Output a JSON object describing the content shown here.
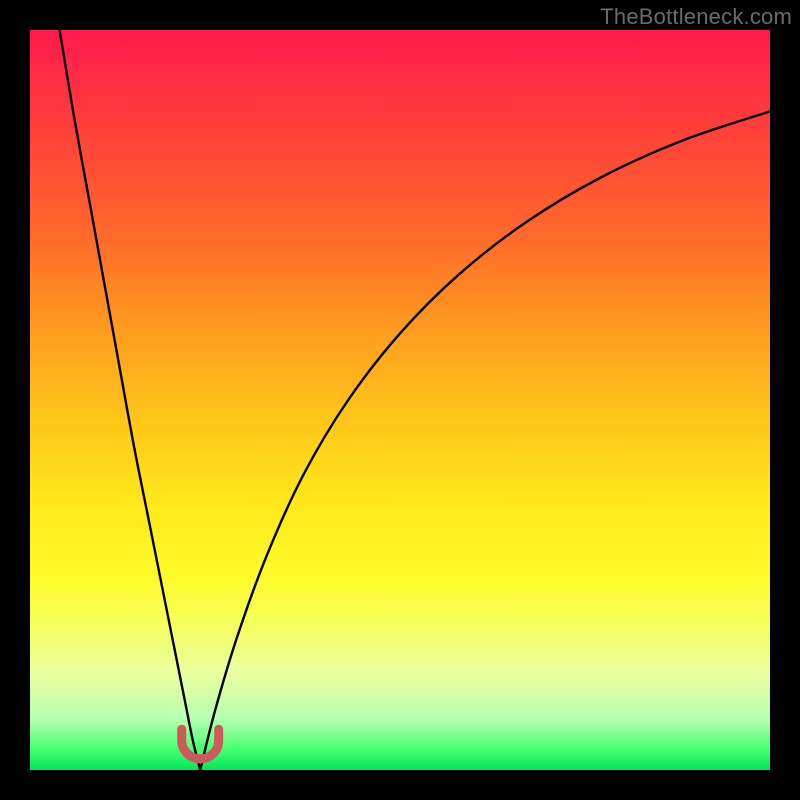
{
  "watermark": {
    "text": "TheBottleneck.com"
  },
  "chart_data": {
    "type": "line",
    "title": "",
    "xlabel": "",
    "ylabel": "",
    "xlim": [
      0,
      100
    ],
    "ylim": [
      0,
      100
    ],
    "background_gradient": {
      "orientation": "vertical",
      "stops": [
        {
          "pos": 0,
          "color": "#ff1a4d"
        },
        {
          "pos": 28,
          "color": "#ff6a2a"
        },
        {
          "pos": 52,
          "color": "#ffc41a"
        },
        {
          "pos": 74,
          "color": "#fffb2a"
        },
        {
          "pos": 93,
          "color": "#b7ffb0"
        },
        {
          "pos": 100,
          "color": "#00e85a"
        }
      ]
    },
    "curve_minimum_x": 23,
    "series": [
      {
        "name": "left-branch",
        "color": "#000000",
        "x": [
          4,
          6,
          8,
          10,
          12,
          14,
          16,
          18,
          20,
          21,
          22,
          23
        ],
        "y": [
          100,
          88,
          77,
          66,
          55,
          44,
          34,
          24,
          14,
          9,
          4,
          0
        ]
      },
      {
        "name": "right-branch",
        "color": "#000000",
        "x": [
          23,
          25,
          28,
          32,
          37,
          43,
          50,
          58,
          67,
          77,
          88,
          100
        ],
        "y": [
          0,
          8,
          18,
          29,
          40,
          50,
          59,
          67,
          74,
          80,
          85,
          89
        ]
      }
    ],
    "marker": {
      "name": "minimum-marker",
      "shape": "u",
      "color": "#cc5a5a",
      "x": 23,
      "y": 1.5,
      "width": 5,
      "height": 4
    }
  }
}
